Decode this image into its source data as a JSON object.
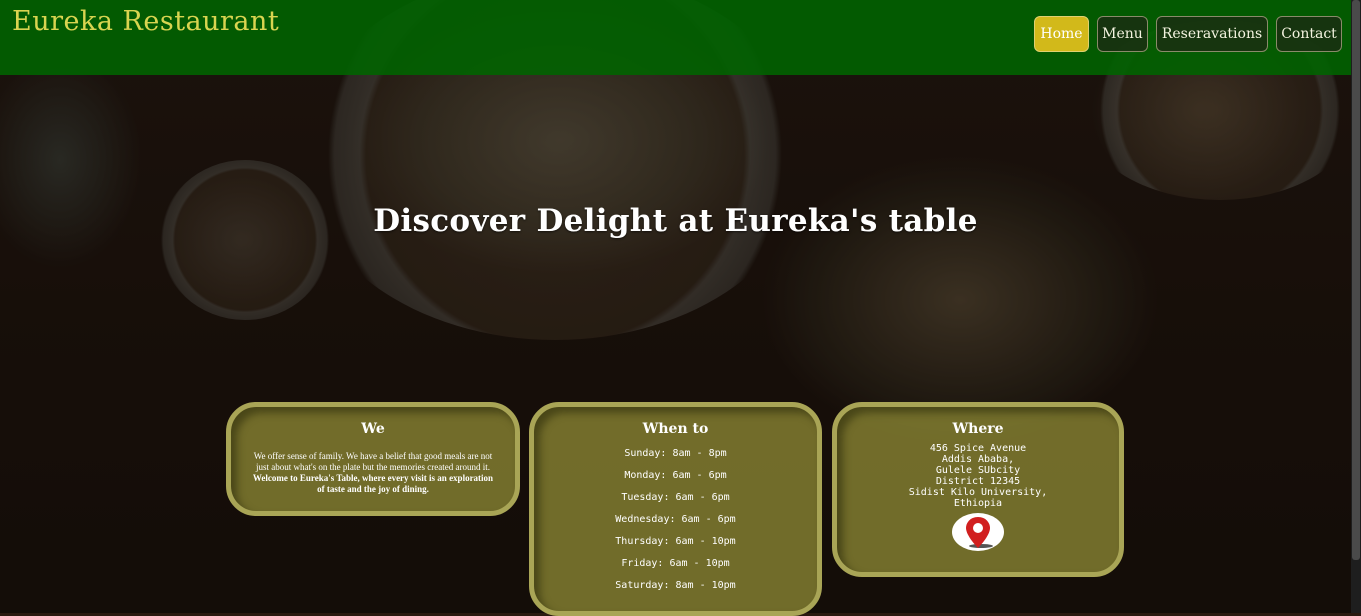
{
  "header": {
    "logo": "Eureka Restaurant",
    "nav": [
      {
        "label": "Home",
        "active": true
      },
      {
        "label": "Menu",
        "active": false
      },
      {
        "label": "Reseravations",
        "active": false
      },
      {
        "label": "Contact",
        "active": false
      }
    ]
  },
  "hero": {
    "title": "Discover Delight at Eureka's table"
  },
  "cards": {
    "we": {
      "title": "We",
      "text": "We offer sense of family. We have a belief that good meals are not just about what's on the plate but the memories created around it.",
      "bold_text": "Welcome to Eureka's Table, where every visit is an exploration of taste and the joy of dining."
    },
    "when": {
      "title": "When to",
      "hours": [
        "Sunday: 8am - 8pm",
        "Monday: 6am - 6pm",
        "Tuesday: 6am - 6pm",
        "Wednesday: 6am - 6pm",
        "Thursday: 6am - 10pm",
        "Friday: 6am - 10pm",
        "Saturday: 8am - 10pm"
      ]
    },
    "where": {
      "title": "Where",
      "address": [
        "456 Spice Avenue",
        "Addis Ababa,",
        "Gulele SUbcity",
        "District 12345",
        "Sidist Kilo University,",
        "Ethiopia"
      ],
      "icon": "map-pin-icon"
    }
  },
  "colors": {
    "header_bg": "#006400",
    "logo": "#d9d450",
    "active_nav": "#d2b91a",
    "card_bg": "#96913a",
    "card_border": "#a9a556"
  }
}
